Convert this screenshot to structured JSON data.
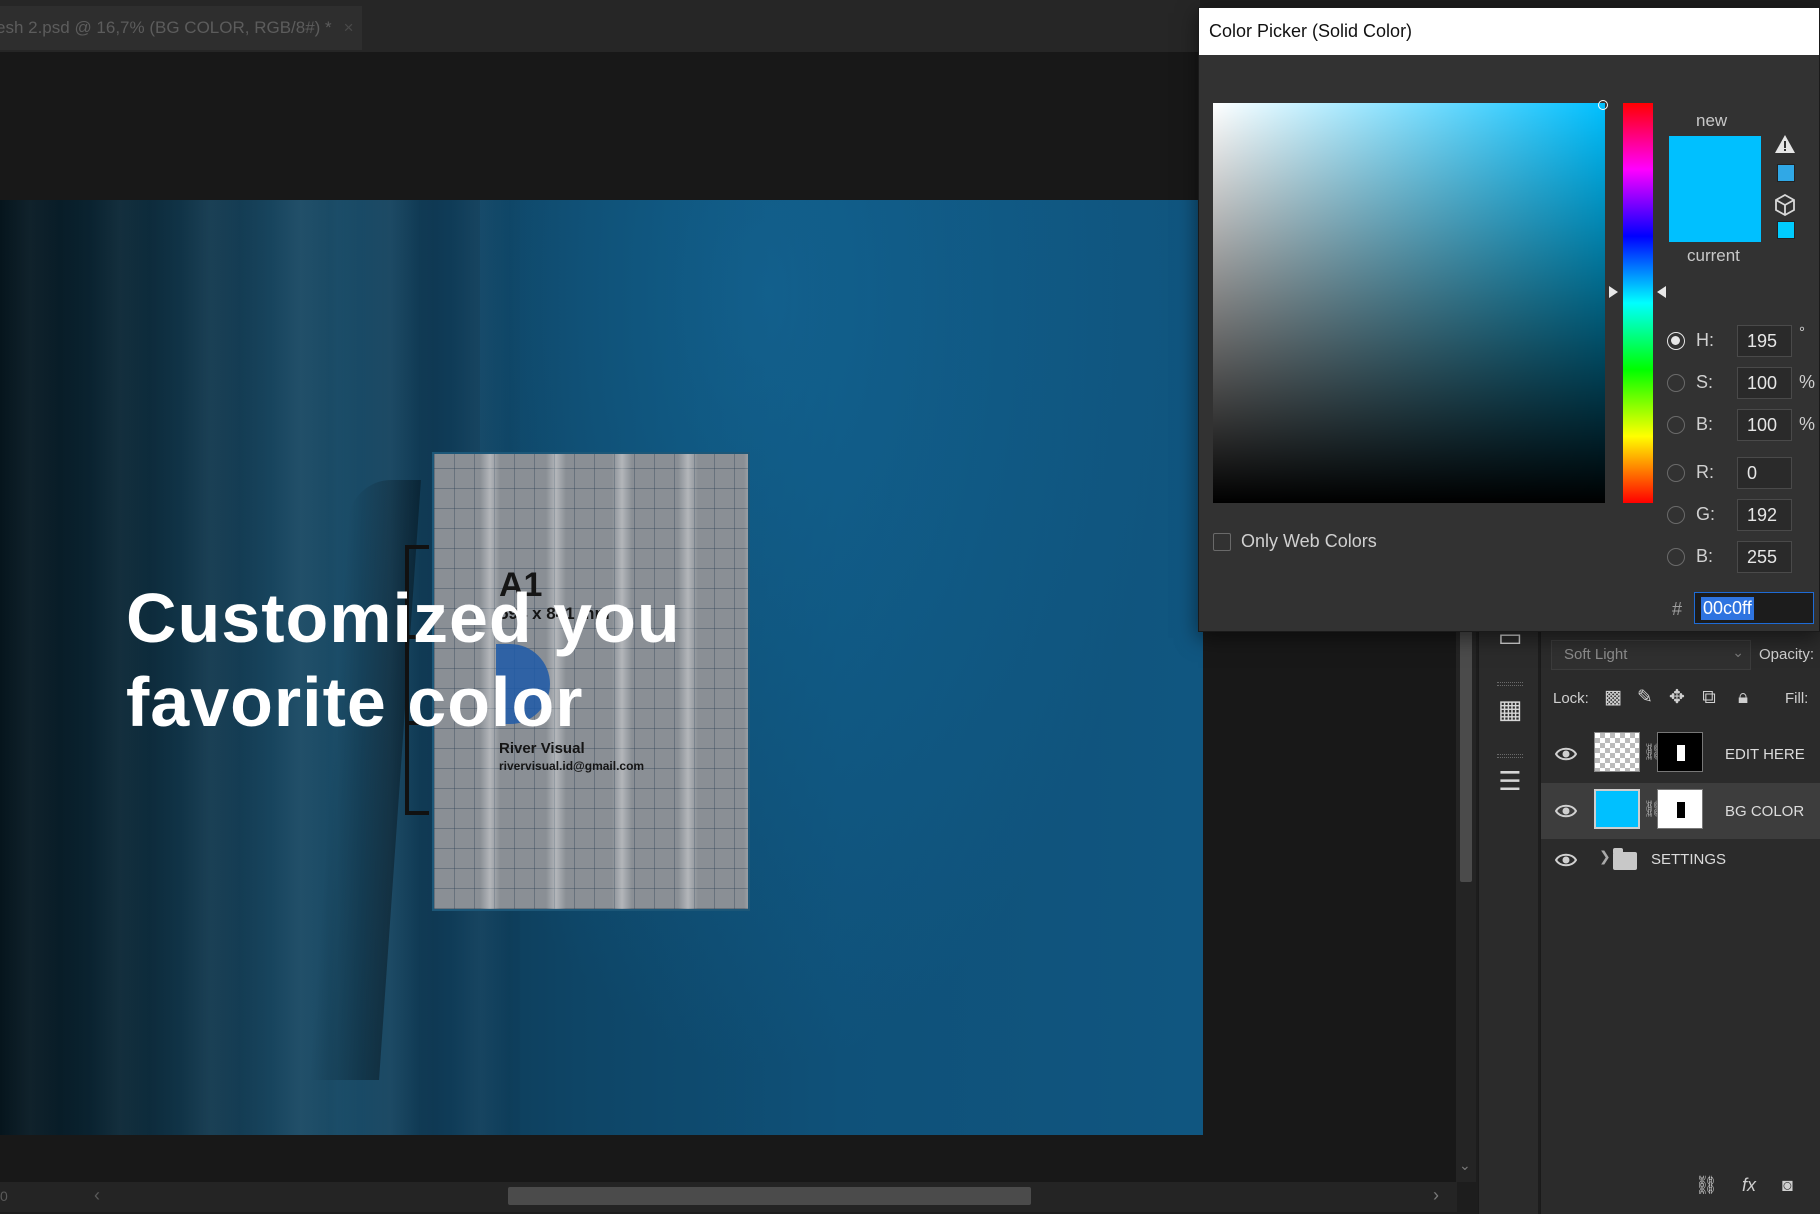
{
  "document": {
    "tab_title": "esh 2.psd @ 16,7% (BG COLOR, RGB/8#) *",
    "tab_close": "×",
    "status": "0"
  },
  "canvas": {
    "headline_line1": "Customized you",
    "headline_line2": "favorite color",
    "poster": {
      "size_code": "A1",
      "dimensions": "594 x 841 mm",
      "brand": "River Visual",
      "email": "rivervisual.id@gmail.com"
    }
  },
  "color_picker": {
    "title": "Color Picker (Solid Color)",
    "new_label": "new",
    "current_label": "current",
    "new_color": "#00c0ff",
    "current_color": "#00c0ff",
    "gamut_swatch_color": "#30a8e6",
    "web_swatch_color": "#00ccff",
    "only_web_colors_label": "Only Web Colors",
    "only_web_colors_checked": false,
    "selected_mode": "H",
    "fields": {
      "h": {
        "label": "H:",
        "value": "195",
        "unit": "°"
      },
      "s": {
        "label": "S:",
        "value": "100",
        "unit": "%"
      },
      "b": {
        "label": "B:",
        "value": "100",
        "unit": "%"
      },
      "r": {
        "label": "R:",
        "value": "0"
      },
      "g": {
        "label": "G:",
        "value": "192"
      },
      "bb": {
        "label": "B:",
        "value": "255"
      }
    },
    "hash_label": "#",
    "hex_value": "00c0ff"
  },
  "layers_panel": {
    "blend_mode": "Soft Light",
    "opacity_label": "Opacity:",
    "lock_label": "Lock:",
    "fill_label": "Fill:",
    "layers": [
      {
        "name": "EDIT HERE",
        "visible": true,
        "selected": false
      },
      {
        "name": "BG COLOR",
        "visible": true,
        "selected": true
      },
      {
        "name": "SETTINGS",
        "visible": true,
        "type": "group"
      }
    ]
  }
}
